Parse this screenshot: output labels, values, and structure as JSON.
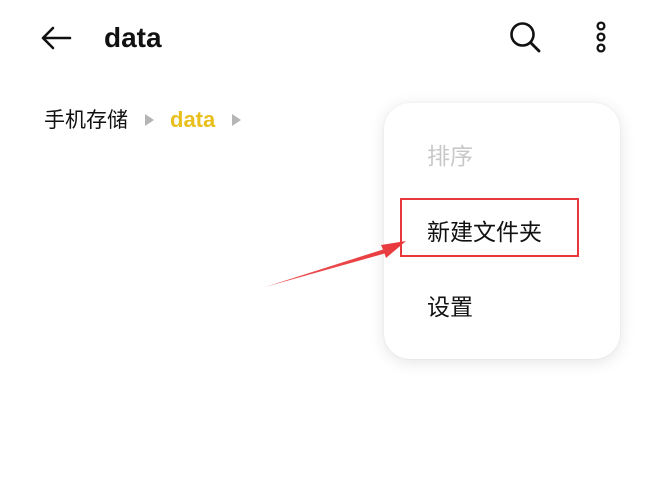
{
  "header": {
    "title": "data",
    "back_icon": "arrow-left-icon",
    "search_icon": "search-icon",
    "more_icon": "more-vertical-icon"
  },
  "breadcrumb": {
    "root": "手机存储",
    "current": "data",
    "separator_icon": "triangle-right-icon"
  },
  "menu": {
    "items": [
      {
        "label": "排序",
        "enabled": false
      },
      {
        "label": "新建文件夹",
        "enabled": true
      },
      {
        "label": "设置",
        "enabled": true
      }
    ]
  },
  "annotation": {
    "highlighted_item": "新建文件夹",
    "color": "#e8383b"
  },
  "colors": {
    "accent": "#e8bf1c",
    "text_primary": "#111111",
    "text_disabled": "#c8c8c8",
    "separator": "#b5b5b5"
  }
}
